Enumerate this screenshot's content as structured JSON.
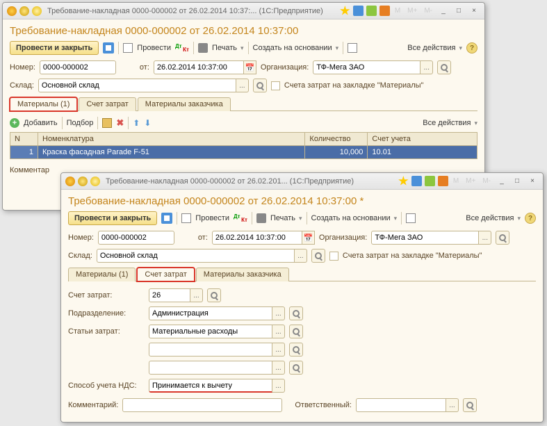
{
  "w1": {
    "titlebar": "Требование-накладная 0000-000002 от 26.02.2014 10:37:...   (1С:Предприятие)",
    "mbtns": [
      "M",
      "M+",
      "M-"
    ],
    "title": "Требование-накладная 0000-000002 от 26.02.2014 10:37:00",
    "btn_main": "Провести и закрыть",
    "btn_post": "Провести",
    "btn_print": "Печать",
    "btn_base": "Создать на основании",
    "all_actions": "Все действия",
    "lbl_num": "Номер:",
    "val_num": "0000-000002",
    "lbl_from": "от:",
    "val_date": "26.02.2014 10:37:00",
    "lbl_org": "Организация:",
    "val_org": "ТФ-Мега ЗАО",
    "lbl_sklad": "Склад:",
    "val_sklad": "Основной склад",
    "chk_label": "Счета затрат на закладке \"Материалы\"",
    "tab1": "Материалы (1)",
    "tab2": "Счет затрат",
    "tab3": "Материалы заказчика",
    "add": "Добавить",
    "select": "Подбор",
    "th_n": "N",
    "th_nom": "Номенклатура",
    "th_qty": "Количество",
    "th_acc": "Счет учета",
    "row_n": "1",
    "row_nom": "Краска фасадная Parade F-51",
    "row_qty": "10,000",
    "row_acc": "10.01",
    "comment": "Комментар"
  },
  "w2": {
    "titlebar": "Требование-накладная 0000-000002 от 26.02.201...   (1С:Предприятие)",
    "mbtns": [
      "M",
      "M+",
      "M-"
    ],
    "title": "Требование-накладная 0000-000002 от 26.02.2014 10:37:00 *",
    "btn_main": "Провести и закрыть",
    "btn_post": "Провести",
    "btn_print": "Печать",
    "btn_base": "Создать на основании",
    "all_actions": "Все действия",
    "lbl_num": "Номер:",
    "val_num": "0000-000002",
    "lbl_from": "от:",
    "val_date": "26.02.2014 10:37:00",
    "lbl_org": "Организация:",
    "val_org": "ТФ-Мега ЗАО",
    "lbl_sklad": "Склад:",
    "val_sklad": "Основной склад",
    "chk_label": "Счета затрат на закладке \"Материалы\"",
    "tab1": "Материалы (1)",
    "tab2": "Счет затрат",
    "tab3": "Материалы заказчика",
    "lbl_acc": "Счет затрат:",
    "val_acc": "26",
    "lbl_dept": "Подразделение:",
    "val_dept": "Администрация",
    "lbl_art": "Статьи затрат:",
    "val_art": "Материальные расходы",
    "lbl_nds": "Способ учета НДС:",
    "val_nds": "Принимается к вычету",
    "lbl_comment": "Комментарий:",
    "lbl_resp": "Ответственный:"
  }
}
